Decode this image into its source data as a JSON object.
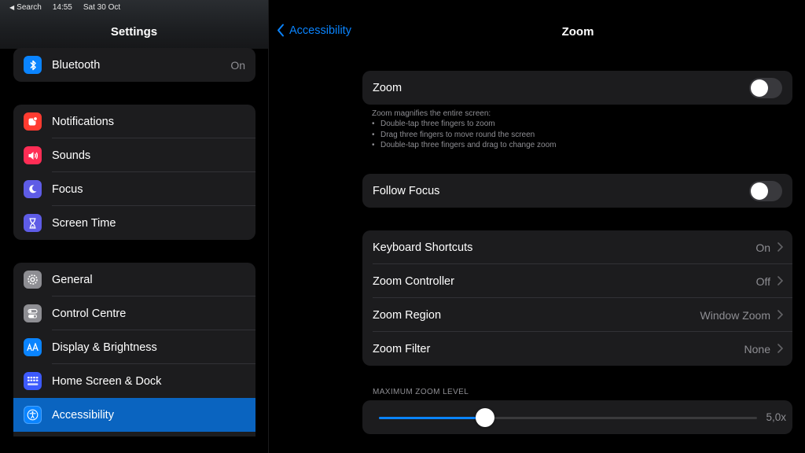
{
  "status_bar": {
    "back_app": "Search",
    "time": "14:55",
    "date": "Sat 30 Oct"
  },
  "sidebar": {
    "title": "Settings",
    "groups": [
      [
        {
          "label": "Bluetooth",
          "value": "On",
          "icon": "bluetooth-icon",
          "color": "#0a84ff"
        }
      ],
      [
        {
          "label": "Notifications",
          "icon": "notifications-icon",
          "color": "#ff3b30"
        },
        {
          "label": "Sounds",
          "icon": "sounds-icon",
          "color": "#ff2d55"
        },
        {
          "label": "Focus",
          "icon": "focus-moon-icon",
          "color": "#5e5ce6"
        },
        {
          "label": "Screen Time",
          "icon": "hourglass-icon",
          "color": "#5e5ce6"
        }
      ],
      [
        {
          "label": "General",
          "icon": "gear-icon",
          "color": "#8e8e93"
        },
        {
          "label": "Control Centre",
          "icon": "control-centre-icon",
          "color": "#8e8e93"
        },
        {
          "label": "Display & Brightness",
          "icon": "display-aa-icon",
          "color": "#0a84ff"
        },
        {
          "label": "Home Screen & Dock",
          "icon": "home-grid-icon",
          "color": "#3d5afe"
        },
        {
          "label": "Accessibility",
          "icon": "accessibility-icon",
          "color": "#0a84ff",
          "selected": true
        }
      ]
    ]
  },
  "main": {
    "back_label": "Accessibility",
    "title": "Zoom",
    "zoom_toggle": {
      "label": "Zoom",
      "on": false
    },
    "footnote": {
      "heading": "Zoom magnifies the entire screen:",
      "bullets": [
        "Double-tap three fingers to zoom",
        "Drag three fingers to move round the screen",
        "Double-tap three fingers and drag to change zoom"
      ]
    },
    "follow_focus": {
      "label": "Follow Focus",
      "on": false
    },
    "options": [
      {
        "label": "Keyboard Shortcuts",
        "value": "On"
      },
      {
        "label": "Zoom Controller",
        "value": "Off"
      },
      {
        "label": "Zoom Region",
        "value": "Window Zoom"
      },
      {
        "label": "Zoom Filter",
        "value": "None"
      }
    ],
    "max_zoom": {
      "header": "MAXIMUM ZOOM LEVEL",
      "value_label": "5,0x",
      "fraction": 0.28
    }
  },
  "colors": {
    "accent": "#0a84ff",
    "selected_row": "#0a64c0",
    "card": "#1c1c1e",
    "secondary_text": "#8e8e93"
  }
}
